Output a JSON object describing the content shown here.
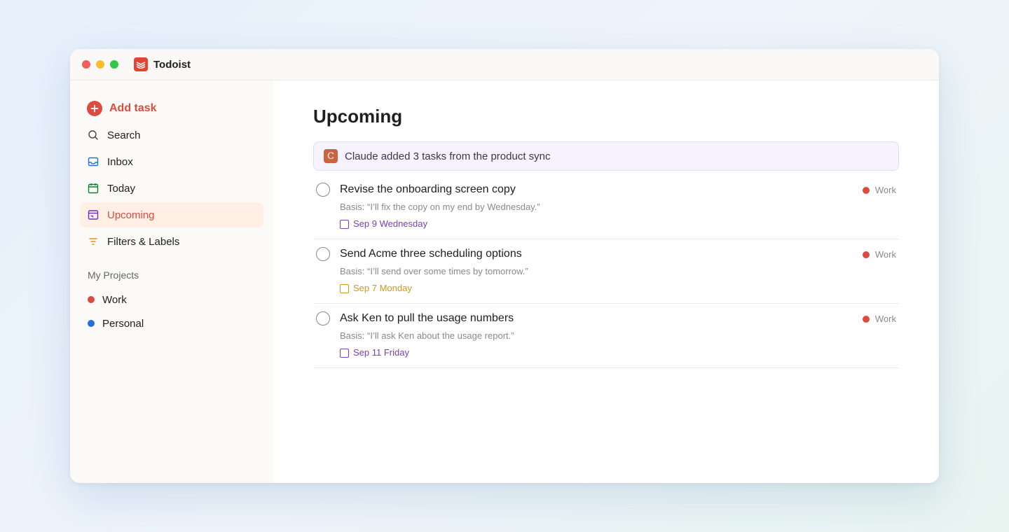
{
  "window": {
    "title": "Todoist"
  },
  "sidebar": {
    "add_task_label": "Add task",
    "items": [
      {
        "label": "Search",
        "icon": "search-icon"
      },
      {
        "label": "Inbox",
        "icon": "inbox-icon"
      },
      {
        "label": "Today",
        "icon": "calendar-today-icon"
      },
      {
        "label": "Upcoming",
        "icon": "calendar-upcoming-icon",
        "active": true
      },
      {
        "label": "Filters & Labels",
        "icon": "filter-icon"
      }
    ],
    "projects_heading": "My Projects",
    "projects": [
      {
        "label": "Work",
        "color": "#dc4c3e"
      },
      {
        "label": "Personal",
        "color": "#246fe0"
      }
    ]
  },
  "main": {
    "title": "Upcoming",
    "banner": {
      "badge": "C",
      "text": "Claude added 3 tasks from the product sync"
    },
    "tasks": [
      {
        "name": "Revise the onboarding screen copy",
        "basis": "Basis: “I’ll fix the copy on my end by Wednesday.”",
        "due": "Sep 9 Wednesday",
        "due_color": "#7a3fc0",
        "project": "Work",
        "project_color": "#dc4c3e"
      },
      {
        "name": "Send Acme three scheduling options",
        "basis": "Basis: “I’ll send over some times by tomorrow.”",
        "due": "Sep 7 Monday",
        "due_color": "#d9951e",
        "project": "Work",
        "project_color": "#dc4c3e"
      },
      {
        "name": "Ask Ken to pull the usage numbers",
        "basis": "Basis: “I’ll ask Ken about the usage report.”",
        "due": "Sep 11 Friday",
        "due_color": "#7a3fc0",
        "project": "Work",
        "project_color": "#dc4c3e"
      }
    ]
  },
  "colors": {
    "accent": "#dc4c3e",
    "active_bg": "#ffefe5",
    "banner_bg": "#f6f3fe"
  }
}
